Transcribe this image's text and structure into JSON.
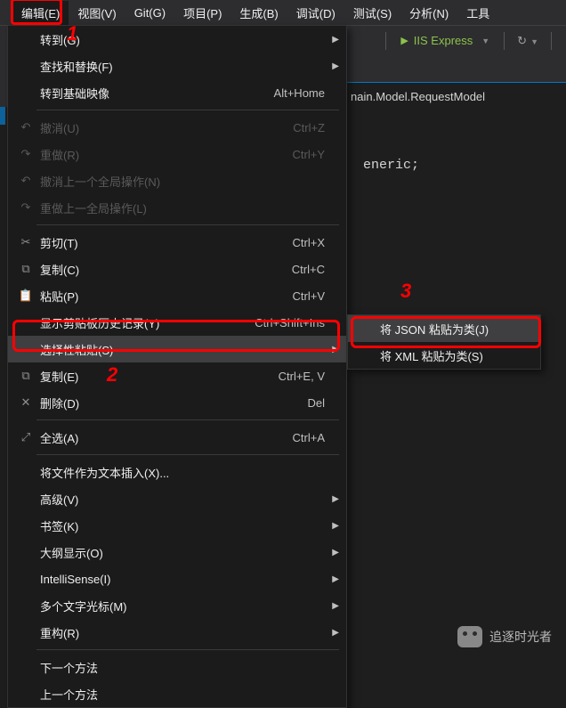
{
  "menubar": {
    "items": [
      {
        "label": "编辑(E)",
        "active": true
      },
      {
        "label": "视图(V)"
      },
      {
        "label": "Git(G)"
      },
      {
        "label": "项目(P)"
      },
      {
        "label": "生成(B)"
      },
      {
        "label": "调试(D)"
      },
      {
        "label": "测试(S)"
      },
      {
        "label": "分析(N)"
      },
      {
        "label": "工具"
      }
    ]
  },
  "toolbar": {
    "run_label": "IIS Express"
  },
  "edit_menu": {
    "items": [
      {
        "label": "转到(G)",
        "arrow": true
      },
      {
        "label": "查找和替换(F)",
        "arrow": true
      },
      {
        "label": "转到基础映像",
        "shortcut": "Alt+Home"
      },
      {
        "sep": true
      },
      {
        "label": "撤消(U)",
        "shortcut": "Ctrl+Z",
        "icon": "undo",
        "disabled": true
      },
      {
        "label": "重做(R)",
        "shortcut": "Ctrl+Y",
        "icon": "redo",
        "disabled": true
      },
      {
        "label": "撤消上一个全局操作(N)",
        "icon": "undo",
        "disabled": true
      },
      {
        "label": "重做上一全局操作(L)",
        "icon": "redo",
        "disabled": true
      },
      {
        "sep": true
      },
      {
        "label": "剪切(T)",
        "shortcut": "Ctrl+X",
        "icon": "cut"
      },
      {
        "label": "复制(C)",
        "shortcut": "Ctrl+C",
        "icon": "copy"
      },
      {
        "label": "粘贴(P)",
        "shortcut": "Ctrl+V",
        "icon": "paste"
      },
      {
        "label": "显示剪贴板历史记录(Y)",
        "shortcut": "Ctrl+Shift+Ins"
      },
      {
        "label": "选择性粘贴(S)",
        "arrow": true,
        "highlighted": true
      },
      {
        "label": "复制(E)",
        "shortcut": "Ctrl+E, V",
        "icon": "duplicate"
      },
      {
        "label": "删除(D)",
        "shortcut": "Del",
        "icon": "delete"
      },
      {
        "sep": true
      },
      {
        "label": "全选(A)",
        "shortcut": "Ctrl+A",
        "icon": "select-all"
      },
      {
        "sep": true
      },
      {
        "label": "将文件作为文本插入(X)..."
      },
      {
        "label": "高级(V)",
        "arrow": true
      },
      {
        "label": "书签(K)",
        "arrow": true
      },
      {
        "label": "大纲显示(O)",
        "arrow": true
      },
      {
        "label": "IntelliSense(I)",
        "arrow": true
      },
      {
        "label": "多个文字光标(M)",
        "arrow": true
      },
      {
        "label": "重构(R)",
        "arrow": true
      },
      {
        "sep": true
      },
      {
        "label": "下一个方法"
      },
      {
        "label": "上一个方法"
      }
    ]
  },
  "paste_special_submenu": {
    "items": [
      {
        "label": "将 JSON 粘贴为类(J)",
        "highlighted": true
      },
      {
        "label": "将 XML 粘贴为类(S)"
      }
    ]
  },
  "annotations": {
    "one": "1",
    "two": "2",
    "three": "3"
  },
  "tab": {
    "label": "nain.Model.RequestModel"
  },
  "code": {
    "line1": "eneric;"
  },
  "watermark": {
    "text": "追逐时光者"
  },
  "icons": {
    "undo": "↶",
    "redo": "↷",
    "cut": "✂",
    "copy": "⧉",
    "paste": "📋",
    "duplicate": "⧉",
    "delete": "✕",
    "select-all": "⤢"
  }
}
